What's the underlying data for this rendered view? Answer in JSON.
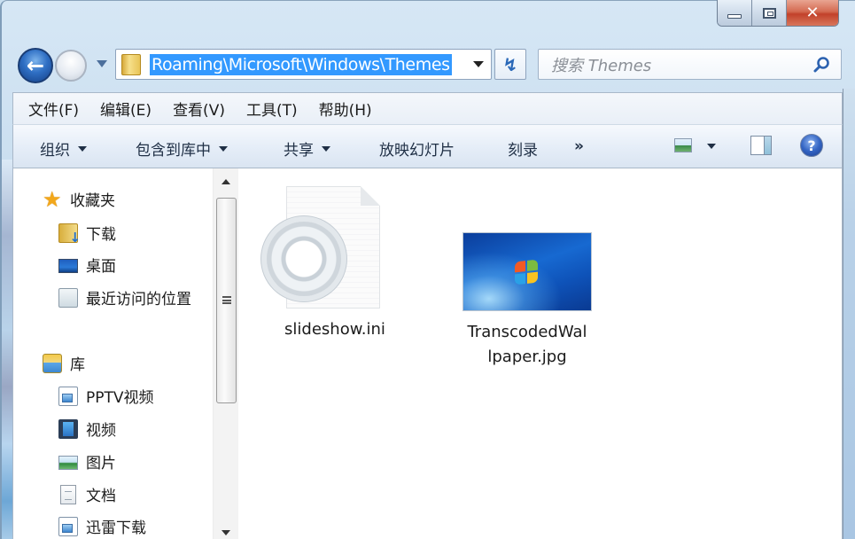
{
  "window": {
    "caption_buttons": {
      "minimize_icon": "minimize-icon",
      "maximize_icon": "maximize-icon",
      "close_icon": "close-icon",
      "close_glyph": "✕"
    }
  },
  "navigation": {
    "back_glyph": "←",
    "address_path": "Roaming\\Microsoft\\Windows\\Themes",
    "refresh_glyph": "↯",
    "search_placeholder": "搜索 Themes"
  },
  "menubar": {
    "items": [
      {
        "label": "文件(F)"
      },
      {
        "label": "编辑(E)"
      },
      {
        "label": "查看(V)"
      },
      {
        "label": "工具(T)"
      },
      {
        "label": "帮助(H)"
      }
    ]
  },
  "toolbar": {
    "organize": "组织",
    "include_in_library": "包含到库中",
    "share": "共享",
    "slideshow": "放映幻灯片",
    "burn": "刻录",
    "more": "»",
    "help_glyph": "?"
  },
  "nav_pane": {
    "favorites": {
      "label": "收藏夹",
      "items": [
        {
          "label": "下载",
          "icon": "download-folder-icon"
        },
        {
          "label": "桌面",
          "icon": "desktop-icon"
        },
        {
          "label": "最近访问的位置",
          "icon": "recent-places-icon"
        }
      ]
    },
    "libraries": {
      "label": "库",
      "items": [
        {
          "label": "PPTV视频",
          "icon": "library-folder-icon"
        },
        {
          "label": "视频",
          "icon": "video-icon"
        },
        {
          "label": "图片",
          "icon": "pictures-icon"
        },
        {
          "label": "文档",
          "icon": "documents-icon"
        },
        {
          "label": "迅雷下载",
          "icon": "library-folder-icon"
        }
      ]
    }
  },
  "content": {
    "files": [
      {
        "name": "slideshow.ini",
        "type": "ini-settings-file"
      },
      {
        "name_line1": "TranscodedWal",
        "name_line2": "lpaper.jpg",
        "type": "jpg-image"
      }
    ]
  }
}
